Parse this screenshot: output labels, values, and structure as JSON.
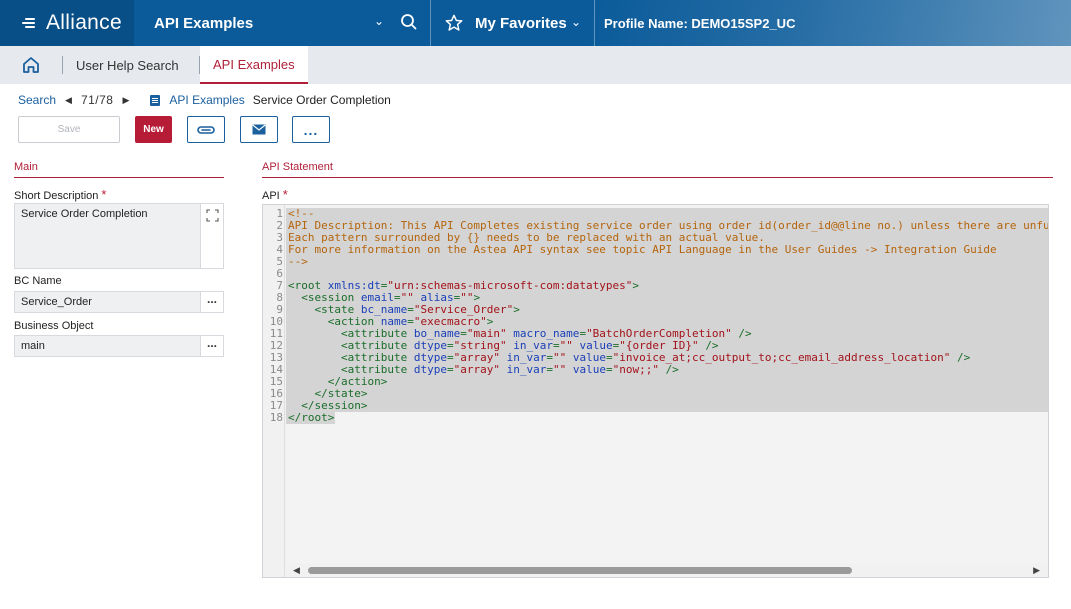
{
  "header": {
    "logo": "Alliance",
    "module_title": "API Examples",
    "favorites_label": "My Favorites",
    "profile": "Profile Name: DEMO15SP2_UC"
  },
  "tabs": [
    {
      "label": "User Help Search"
    },
    {
      "label": "API Examples"
    }
  ],
  "breadcrumb": {
    "search": "Search",
    "record_count": "71/78",
    "section": "API Examples",
    "current": "Service Order Completion"
  },
  "toolbar": {
    "save_label": "Save",
    "new_label": "New",
    "more_label": "..."
  },
  "main": {
    "header": "Main",
    "short_description_label": "Short Description",
    "short_description_value": "Service Order Completion",
    "bc_name_label": "BC Name",
    "bc_name_value": "Service_Order",
    "business_object_label": "Business Object",
    "business_object_value": "main",
    "lookup_button": "..."
  },
  "api_statement": {
    "header": "API Statement",
    "api_label": "API",
    "required_marker": "*",
    "lines": [
      "<!--",
      "API Description: This API Completes existing service order using order id(order_id@@line no.) unless there are unfu",
      "Each pattern surrounded by {} needs to be replaced with an actual value.",
      "For more information on the Astea API syntax see topic API Language in the User Guides -> Integration Guide",
      "-->",
      "",
      "<root xmlns:dt=\"urn:schemas-microsoft-com:datatypes\">",
      "  <session email=\"\" alias=\"\">",
      "    <state bc_name=\"Service_Order\">",
      "      <action name=\"execmacro\">",
      "        <attribute bo_name=\"main\" macro_name=\"BatchOrderCompletion\" />",
      "        <attribute dtype=\"string\" in_var=\"\" value=\"{order ID}\" />",
      "        <attribute dtype=\"array\" in_var=\"\" value=\"invoice_at;cc_output_to;cc_email_address_location\" />",
      "        <attribute dtype=\"array\" in_var=\"\" value=\"now;;\" />",
      "      </action>",
      "    </state>",
      "  </session>",
      "</root>"
    ],
    "line_numbers": [
      "1",
      "2",
      "3",
      "4",
      "5",
      "6",
      "7",
      "8",
      "9",
      "10",
      "11",
      "12",
      "13",
      "14",
      "15",
      "16",
      "17",
      "18"
    ]
  },
  "colors": {
    "header_bg": "#0b5b9a",
    "accent_red": "#b01f38",
    "link_blue": "#1a5f9e"
  }
}
